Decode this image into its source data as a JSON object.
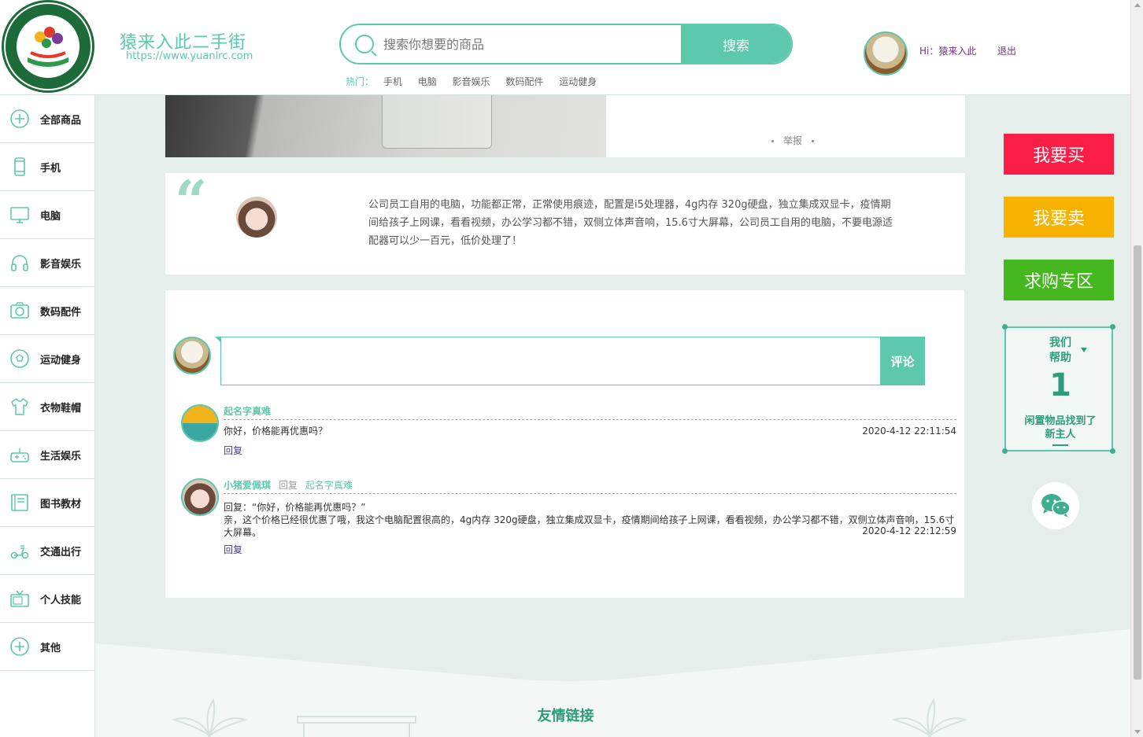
{
  "header": {
    "site_name": "猿来入此二手街",
    "site_url": "https://www.yuanlrc.com",
    "search_placeholder": "搜索你想要的商品",
    "search_button": "搜索",
    "hot_label": "热门：",
    "hot_items": [
      "手机",
      "电脑",
      "影音娱乐",
      "数码配件",
      "运动健身"
    ],
    "greeting": "Hi：猿来入此",
    "logout": "退出"
  },
  "sidebar": {
    "items": [
      {
        "label": "全部商品",
        "icon": "plus-circle-icon"
      },
      {
        "label": "手机",
        "icon": "phone-icon"
      },
      {
        "label": "电脑",
        "icon": "monitor-icon"
      },
      {
        "label": "影音娱乐",
        "icon": "headphones-icon"
      },
      {
        "label": "数码配件",
        "icon": "camera-icon"
      },
      {
        "label": "运动健身",
        "icon": "soccer-ball-icon"
      },
      {
        "label": "衣物鞋帽",
        "icon": "shirt-icon"
      },
      {
        "label": "生活娱乐",
        "icon": "gamepad-icon"
      },
      {
        "label": "图书教材",
        "icon": "book-icon"
      },
      {
        "label": "交通出行",
        "icon": "scooter-icon"
      },
      {
        "label": "个人技能",
        "icon": "tv-icon"
      },
      {
        "label": "其他",
        "icon": "plus-circle-icon"
      }
    ]
  },
  "product": {
    "report": "举报",
    "description": "公司员工自用的电脑，功能都正常，正常使用痕迹，配置是i5处理器，4g内存 320g硬盘，独立集成双显卡，疫情期间给孩子上网课，看看视频，办公学习都不错，双侧立体声音响，15.6寸大屏幕，公司员工自用的电脑，不要电源适配器可以少一百元，低价处理了！"
  },
  "comments": {
    "submit_label": "评论",
    "list": [
      {
        "name": "起名字真难",
        "text": "你好，价格能再优惠吗？",
        "time": "2020-4-12 22:11:54",
        "reply_label": "回复"
      },
      {
        "name": "小猪爱佩琪",
        "reply_word": "回复",
        "target": "起名字真难",
        "quote": "回复：“你好，价格能再优惠吗？”",
        "text": "亲，这个价格已经很优惠了哦，我这个电脑配置很高的，4g内存 320g硬盘，独立集成双显卡，疫情期间给孩子上网课，看看视频，办公学习都不错，双侧立体声音响，15.6寸大屏幕。",
        "time": "2020-4-12 22:12:59",
        "reply_label": "回复"
      }
    ]
  },
  "right_panel": {
    "buy": "我要买",
    "sell": "我要卖",
    "want": "求购专区",
    "help_title_1": "我们",
    "help_title_2": "帮助",
    "help_count": "1",
    "help_sub_1": "闲置物品找到了",
    "help_sub_2": "新主人"
  },
  "footer": {
    "friend_links": "友情链接"
  },
  "colors": {
    "accent": "#5ec8ad",
    "buy": "#fa1e46",
    "sell": "#f7b200",
    "want": "#44b81e",
    "background": "#e6eeec"
  }
}
